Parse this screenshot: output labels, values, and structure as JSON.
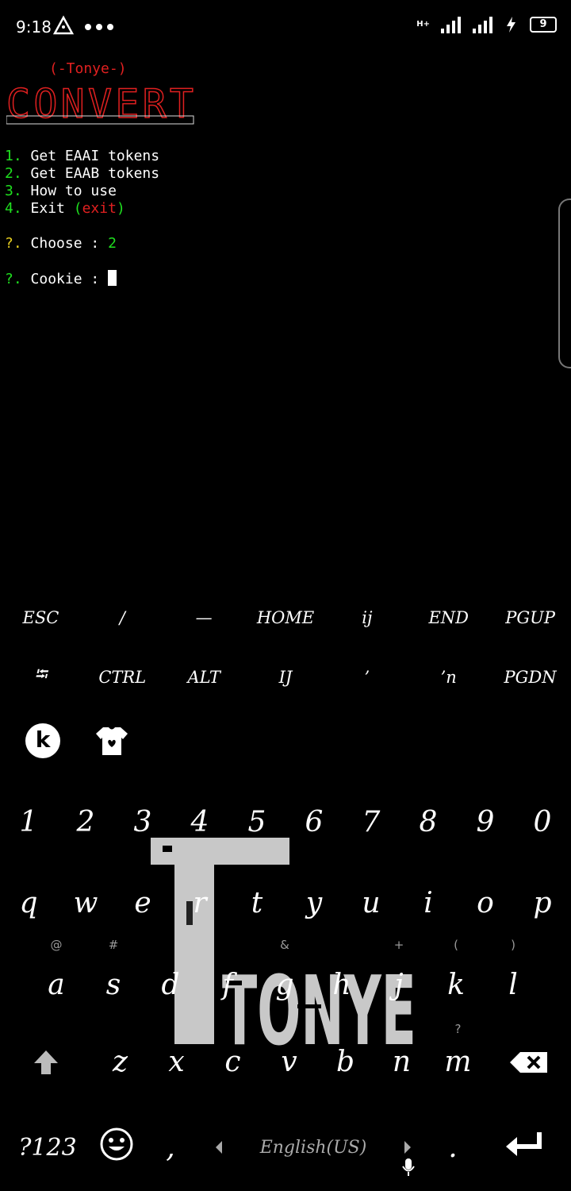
{
  "status": {
    "time": "9:18",
    "network": "H+",
    "battery": "9"
  },
  "terminal": {
    "brand": "(-Tonye-)",
    "banner": "CONVERT",
    "menu": [
      {
        "num": "1.",
        "text": "Get EAAI tokens"
      },
      {
        "num": "2.",
        "text": "Get EAAB tokens"
      },
      {
        "num": "3.",
        "text": "How to use"
      },
      {
        "num": "4.",
        "text": "Exit",
        "extra": "exit"
      }
    ],
    "prompt_mark": "?.",
    "choose_label": "Choose :",
    "choose_value": "2",
    "cookie_label": "Cookie :"
  },
  "extra_keys": {
    "row1": [
      "ESC",
      "/",
      "—",
      "HOME",
      "ij",
      "END",
      "PGUP"
    ],
    "row2": [
      "⭾",
      "CTRL",
      "ALT",
      "IJ",
      "’",
      "’n",
      "PGDN"
    ]
  },
  "keyboard": {
    "numbers": [
      "1",
      "2",
      "3",
      "4",
      "5",
      "6",
      "7",
      "8",
      "9",
      "0"
    ],
    "row_q": [
      "q",
      "w",
      "e",
      "r",
      "t",
      "y",
      "u",
      "i",
      "o",
      "p"
    ],
    "row_a": [
      "a",
      "s",
      "d",
      "f",
      "g",
      "h",
      "j",
      "k",
      "l"
    ],
    "row_a_hints": [
      "@",
      "#",
      "",
      "",
      "&",
      "",
      "+",
      "(",
      ")"
    ],
    "row_z": [
      "z",
      "x",
      "c",
      "v",
      "b",
      "n",
      "m"
    ],
    "row_z_hints": [
      "",
      "",
      "",
      "",
      "",
      "",
      "?"
    ],
    "symbols_label": "?123",
    "comma": ",",
    "language": "English(US)",
    "period": ".",
    "logo_text": "TONYE"
  },
  "colors": {
    "banner": "#e02020",
    "menu_number": "#1fe01f",
    "prompt": "#e8d020"
  }
}
